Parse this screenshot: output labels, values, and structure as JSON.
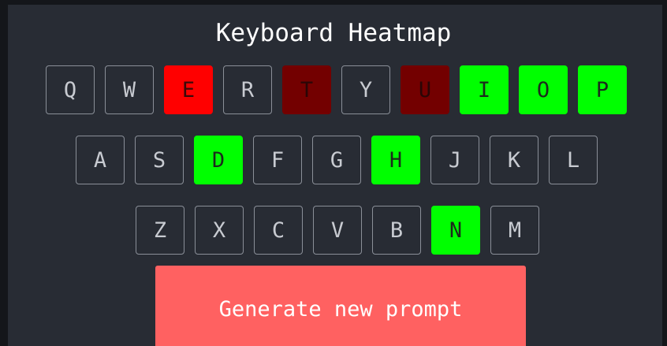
{
  "title": "Keyboard Heatmap",
  "heat_colors": {
    "neutral": "#282c34",
    "high_red": "#ff0000",
    "dark_red": "#730000",
    "green": "#00ff00"
  },
  "keyboard": {
    "rows": [
      [
        {
          "label": "Q",
          "heat": "neutral"
        },
        {
          "label": "W",
          "heat": "neutral"
        },
        {
          "label": "E",
          "heat": "high_red"
        },
        {
          "label": "R",
          "heat": "neutral"
        },
        {
          "label": "T",
          "heat": "dark_red"
        },
        {
          "label": "Y",
          "heat": "neutral"
        },
        {
          "label": "U",
          "heat": "dark_red"
        },
        {
          "label": "I",
          "heat": "green"
        },
        {
          "label": "O",
          "heat": "green"
        },
        {
          "label": "P",
          "heat": "green"
        }
      ],
      [
        {
          "label": "A",
          "heat": "neutral"
        },
        {
          "label": "S",
          "heat": "neutral"
        },
        {
          "label": "D",
          "heat": "green"
        },
        {
          "label": "F",
          "heat": "neutral"
        },
        {
          "label": "G",
          "heat": "neutral"
        },
        {
          "label": "H",
          "heat": "green"
        },
        {
          "label": "J",
          "heat": "neutral"
        },
        {
          "label": "K",
          "heat": "neutral"
        },
        {
          "label": "L",
          "heat": "neutral"
        }
      ],
      [
        {
          "label": "Z",
          "heat": "neutral"
        },
        {
          "label": "X",
          "heat": "neutral"
        },
        {
          "label": "C",
          "heat": "neutral"
        },
        {
          "label": "V",
          "heat": "neutral"
        },
        {
          "label": "B",
          "heat": "neutral"
        },
        {
          "label": "N",
          "heat": "green"
        },
        {
          "label": "M",
          "heat": "neutral"
        }
      ]
    ]
  },
  "generate_button": {
    "label": "Generate new prompt",
    "color": "#ff6161"
  }
}
